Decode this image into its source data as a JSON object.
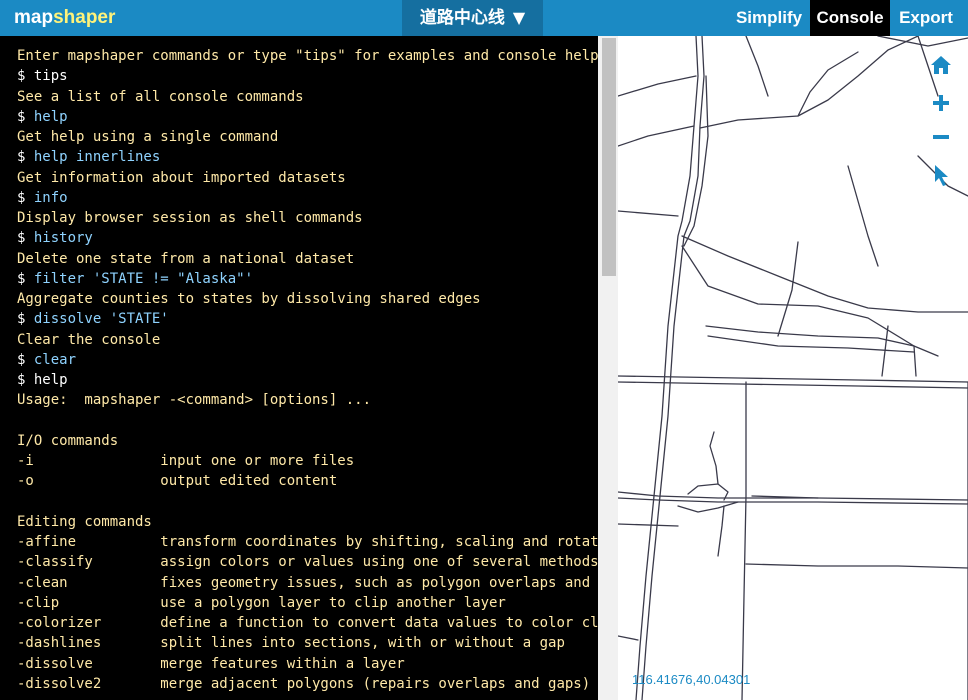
{
  "header": {
    "logo_part1": "map",
    "logo_part2": "shaper",
    "layer_name": "道路中心线",
    "layer_caret": "▼",
    "nav": {
      "simplify": "Simplify",
      "console": "Console",
      "export": "Export"
    }
  },
  "console": {
    "lines": [
      {
        "kind": "msg",
        "text": "Enter mapshaper commands or type \"tips\" for examples and console help"
      },
      {
        "kind": "cmd",
        "text": "tips"
      },
      {
        "kind": "msg",
        "text": "See a list of all console commands"
      },
      {
        "kind": "prev",
        "text": "help"
      },
      {
        "kind": "msg",
        "text": "Get help using a single command"
      },
      {
        "kind": "prev",
        "text": "help innerlines"
      },
      {
        "kind": "msg",
        "text": "Get information about imported datasets"
      },
      {
        "kind": "prev",
        "text": "info"
      },
      {
        "kind": "msg",
        "text": "Display browser session as shell commands"
      },
      {
        "kind": "prev",
        "text": "history"
      },
      {
        "kind": "msg",
        "text": "Delete one state from a national dataset"
      },
      {
        "kind": "prev",
        "text": "filter 'STATE != \"Alaska\"'"
      },
      {
        "kind": "msg",
        "text": "Aggregate counties to states by dissolving shared edges"
      },
      {
        "kind": "prev",
        "text": "dissolve 'STATE'"
      },
      {
        "kind": "msg",
        "text": "Clear the console"
      },
      {
        "kind": "prev",
        "text": "clear"
      },
      {
        "kind": "cmd",
        "text": "help"
      },
      {
        "kind": "msg",
        "text": "Usage:  mapshaper -<command> [options] ..."
      },
      {
        "kind": "msg",
        "text": ""
      },
      {
        "kind": "msg",
        "text": "I/O commands"
      },
      {
        "kind": "msg",
        "text": "-i               input one or more files"
      },
      {
        "kind": "msg",
        "text": "-o               output edited content"
      },
      {
        "kind": "msg",
        "text": ""
      },
      {
        "kind": "msg",
        "text": "Editing commands"
      },
      {
        "kind": "msg",
        "text": "-affine          transform coordinates by shifting, scaling and rotating"
      },
      {
        "kind": "msg",
        "text": "-classify        assign colors or values using one of several methods"
      },
      {
        "kind": "msg",
        "text": "-clean           fixes geometry issues, such as polygon overlaps and gaps"
      },
      {
        "kind": "msg",
        "text": "-clip            use a polygon layer to clip another layer"
      },
      {
        "kind": "msg",
        "text": "-colorizer       define a function to convert data values to color classes"
      },
      {
        "kind": "msg",
        "text": "-dashlines       split lines into sections, with or without a gap"
      },
      {
        "kind": "msg",
        "text": "-dissolve        merge features within a layer"
      },
      {
        "kind": "msg",
        "text": "-dissolve2       merge adjacent polygons (repairs overlaps and gaps)"
      }
    ],
    "prompt": "$ "
  },
  "map": {
    "coordinates": "116.41676,40.04301",
    "tools": [
      "home-icon",
      "zoom-in-icon",
      "zoom-out-icon",
      "pointer-icon"
    ],
    "tool_color": "#1b8ac4",
    "road_color": "#3a3a4a"
  }
}
